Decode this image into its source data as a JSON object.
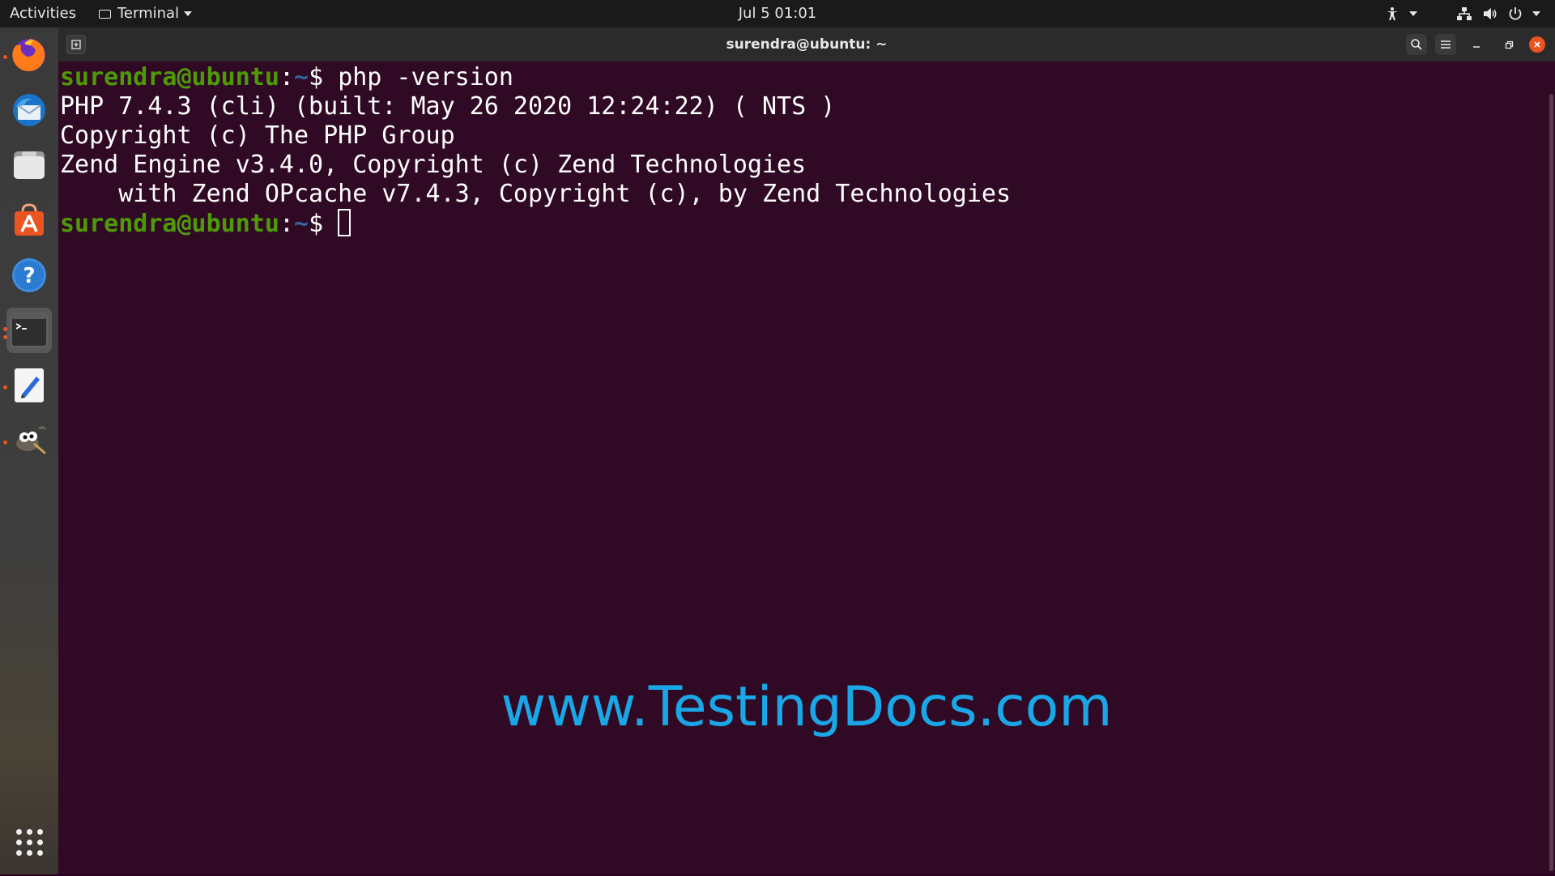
{
  "topbar": {
    "activities": "Activities",
    "app_menu": "Terminal",
    "clock": "Jul 5  01:01",
    "icons": [
      "accessibility-icon",
      "network-icon",
      "volume-icon",
      "power-icon"
    ]
  },
  "dock": {
    "items": [
      {
        "name": "firefox",
        "running": true
      },
      {
        "name": "thunderbird",
        "running": false
      },
      {
        "name": "files",
        "running": false
      },
      {
        "name": "software",
        "running": false
      },
      {
        "name": "help",
        "running": false
      },
      {
        "name": "terminal",
        "running": true,
        "active": true
      },
      {
        "name": "text-editor",
        "running": true
      },
      {
        "name": "gimp",
        "running": true
      }
    ]
  },
  "window": {
    "title": "surendra@ubuntu: ~"
  },
  "terminal": {
    "prompt_user": "surendra@ubuntu",
    "prompt_colon": ":",
    "prompt_path": "~",
    "prompt_dollar": "$ ",
    "command": "php -version",
    "output": [
      "PHP 7.4.3 (cli) (built: May 26 2020 12:24:22) ( NTS )",
      "Copyright (c) The PHP Group",
      "Zend Engine v3.4.0, Copyright (c) Zend Technologies",
      "    with Zend OPcache v7.4.3, Copyright (c), by Zend Technologies"
    ]
  },
  "watermark": "www.TestingDocs.com",
  "colors": {
    "terminal_bg": "#300a24",
    "prompt_user": "#4e9a06",
    "prompt_path": "#3465a4",
    "accent": "#e95420",
    "watermark": "#1aa7e8"
  }
}
